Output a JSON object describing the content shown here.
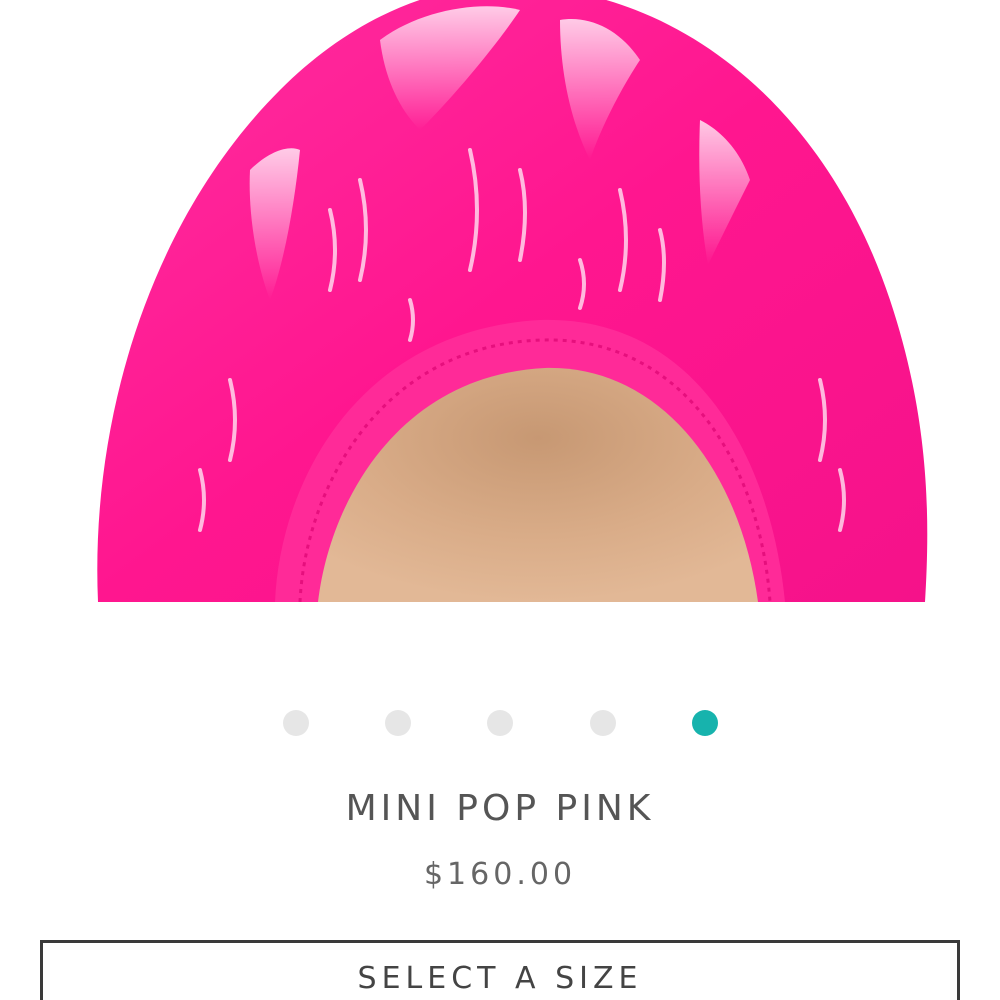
{
  "product": {
    "image_alt": "Pink patent leather flat shoe close-up",
    "name": "MINI POP PINK",
    "price": "$160.00",
    "color_swatch": "#ff1493"
  },
  "carousel": {
    "total_slides": 5,
    "active_index": 4,
    "active_color": "#17b3ad",
    "inactive_color": "#e6e6e6"
  },
  "actions": {
    "select_size_label": "SELECT A SIZE"
  }
}
